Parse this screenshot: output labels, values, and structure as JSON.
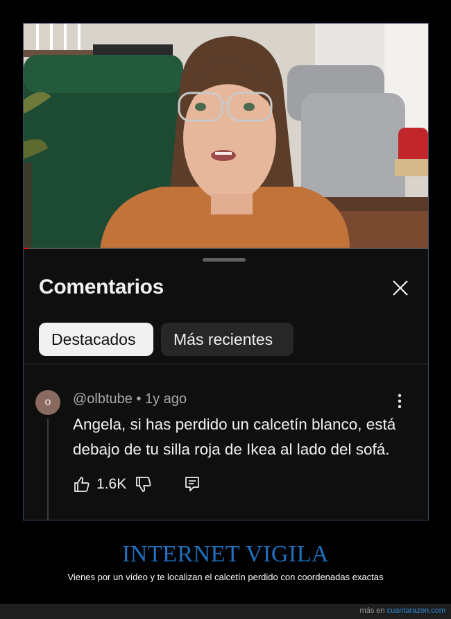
{
  "sheet": {
    "title": "Comentarios",
    "chips": [
      "Destacados",
      "Más recientes"
    ]
  },
  "comment": {
    "avatar_letter": "o",
    "author": "@olbtube",
    "time": "1y ago",
    "text": "Angela, si has perdido un calcetín blanco, está debajo de tu silla roja de Ikea al lado del sofá.",
    "likes": "1.6K"
  },
  "caption": {
    "headline": "INTERNET VIGILA",
    "subline": "Vienes por un vídeo y te localizan el calcetín perdido con coordenadas exactas"
  },
  "footer": {
    "prefix": "más en",
    "site": "cuantarazon.com"
  },
  "colors": {
    "accent_headline": "#1f6fbd",
    "link": "#2f8ad8",
    "sheet_bg": "#0f0f0f"
  }
}
